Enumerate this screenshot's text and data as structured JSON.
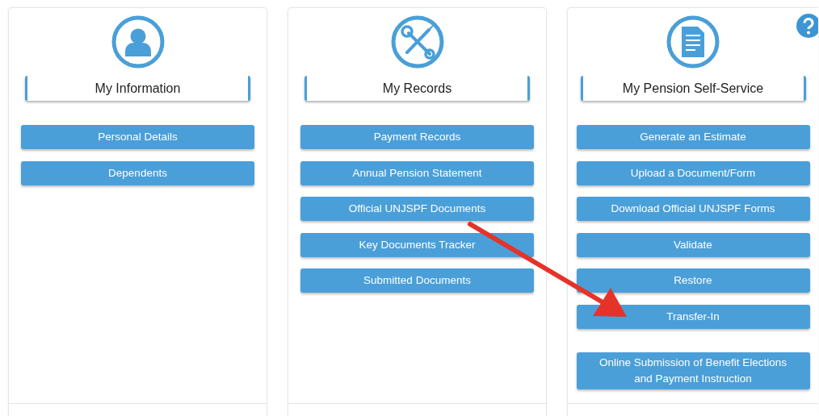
{
  "panels": [
    {
      "title": "My Information",
      "buttons": [
        "Personal Details",
        "Dependents"
      ]
    },
    {
      "title": "My Records",
      "buttons": [
        "Payment Records",
        "Annual Pension Statement",
        "Official UNJSPF Documents",
        "Key Documents Tracker",
        "Submitted Documents"
      ]
    },
    {
      "title": "My Pension Self-Service",
      "buttons": [
        "Generate an Estimate",
        "Upload a Document/Form",
        "Download Official UNJSPF Forms",
        "Validate",
        "Restore",
        "Transfer-In"
      ],
      "more_buttons": [
        "Online Submission of Benefit Elections and Payment Instruction"
      ]
    }
  ]
}
